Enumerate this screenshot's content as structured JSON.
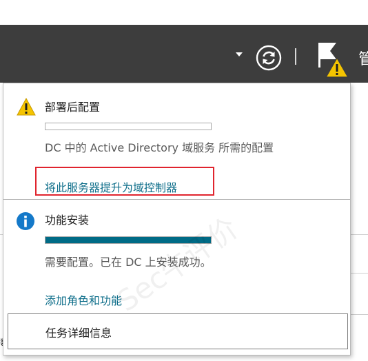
{
  "header": {
    "menu_label_partial": "管",
    "icons": {
      "dropdown": "caret-down-icon",
      "refresh": "refresh-icon",
      "notifications": "flag-warning-icon"
    }
  },
  "notifications": [
    {
      "status": "warning",
      "icon": "warning-icon",
      "title": "部署后配置",
      "progress": 0,
      "description": "DC 中的 Active Directory 域服务 所需的配置",
      "link": "将此服务器提升为域控制器"
    },
    {
      "status": "info",
      "icon": "info-icon",
      "title": "功能安装",
      "progress": 1,
      "description": "需要配置。已在 DC 上安装成功。",
      "link": "添加角色和功能"
    }
  ],
  "footer": {
    "task_details_label": "任务详细信息"
  },
  "watermark": "Sec牛评价",
  "colors": {
    "header_bg": "#3d3d3d",
    "link": "#0e6e8a",
    "progress_fill": "#006b86",
    "highlight": "#e0242e",
    "warning": "#f5c400",
    "info": "#1479c9"
  }
}
